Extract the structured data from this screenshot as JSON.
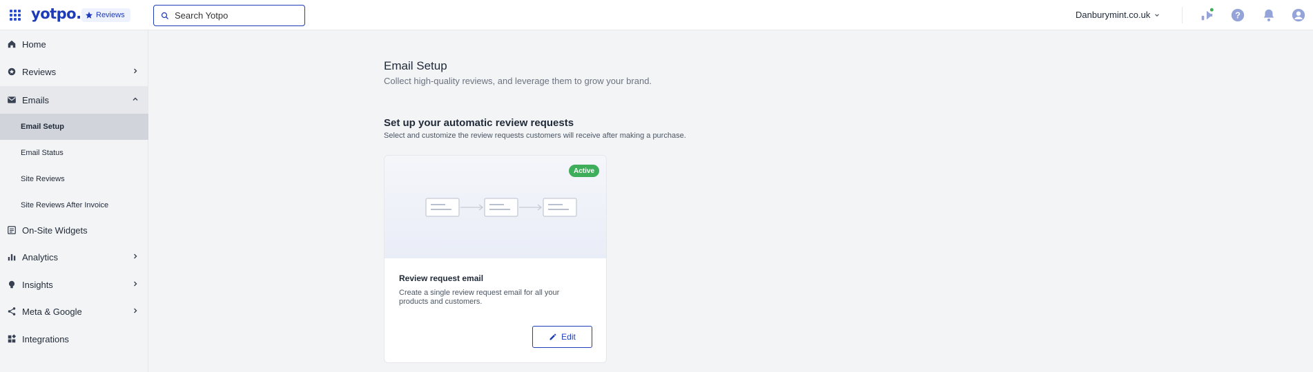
{
  "header": {
    "logo": "yotpo.",
    "product_chip": "Reviews",
    "search_placeholder": "Search Yotpo",
    "store_name": "Danburymint.co.uk"
  },
  "sidebar": {
    "items": [
      {
        "label": "Home",
        "icon": "home-icon"
      },
      {
        "label": "Reviews",
        "icon": "reviews-icon"
      },
      {
        "label": "Emails",
        "icon": "mail-icon"
      },
      {
        "label": "On-Site Widgets",
        "icon": "widget-icon"
      },
      {
        "label": "Analytics",
        "icon": "analytics-icon"
      },
      {
        "label": "Insights",
        "icon": "lightbulb-icon"
      },
      {
        "label": "Meta & Google",
        "icon": "share-icon"
      },
      {
        "label": "Integrations",
        "icon": "integrations-icon"
      }
    ],
    "emails_subitems": [
      {
        "label": "Email Setup",
        "active": true
      },
      {
        "label": "Email Status"
      },
      {
        "label": "Site Reviews"
      },
      {
        "label": "Site Reviews After Invoice"
      }
    ]
  },
  "main": {
    "title": "Email Setup",
    "subtitle": "Collect high-quality reviews, and leverage them to grow your brand.",
    "section_title": "Set up your automatic review requests",
    "section_subtitle": "Select and customize the review requests customers will receive after making a purchase.",
    "card": {
      "badge": "Active",
      "title": "Review request email",
      "description": "Create a single review request email for all your products and customers.",
      "edit_label": "Edit"
    }
  },
  "colors": {
    "brand": "#1e3bb8",
    "active_badge": "#3fae5a",
    "notification_dot": "#3fae5a",
    "top_icons": "#94a3d8"
  }
}
